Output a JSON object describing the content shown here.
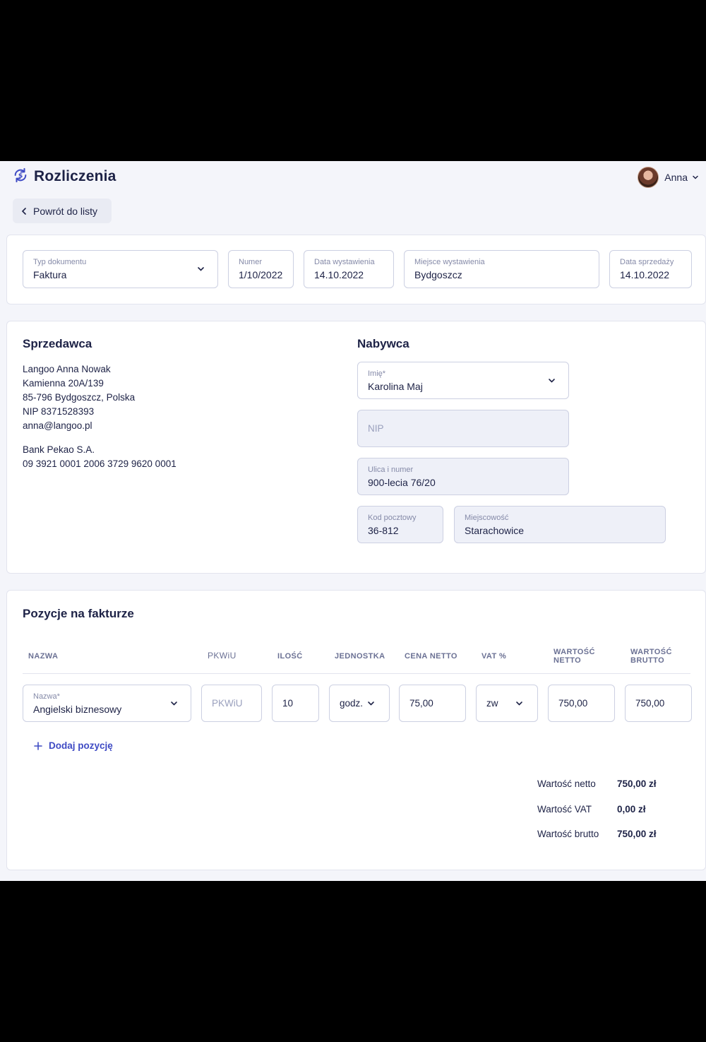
{
  "app": {
    "title": "Rozliczenia",
    "logo_icon": "refresh-coin-icon"
  },
  "user": {
    "name": "Anna"
  },
  "back": {
    "label": "Powrót do listy"
  },
  "document": {
    "type": {
      "label": "Typ dokumentu",
      "value": "Faktura"
    },
    "number": {
      "label": "Numer",
      "value": "1/10/2022"
    },
    "issue_date": {
      "label": "Data wystawienia",
      "value": "14.10.2022"
    },
    "issue_place": {
      "label": "Miejsce wystawienia",
      "value": "Bydgoszcz"
    },
    "sale_date": {
      "label": "Data sprzedaży",
      "value": "14.10.2022"
    }
  },
  "seller": {
    "title": "Sprzedawca",
    "lines": [
      "Langoo Anna Nowak",
      "Kamienna 20A/139",
      "85-796 Bydgoszcz, Polska",
      "NIP 8371528393",
      "anna@langoo.pl"
    ],
    "bank_lines": [
      "Bank Pekao S.A.",
      "09 3921 0001 2006 3729 9620 0001"
    ]
  },
  "buyer": {
    "title": "Nabywca",
    "name": {
      "label": "Imię*",
      "value": "Karolina Maj"
    },
    "nip": {
      "placeholder": "NIP"
    },
    "street": {
      "label": "Ulica i numer",
      "value": "900-lecia 76/20"
    },
    "postal": {
      "label": "Kod pocztowy",
      "value": "36-812"
    },
    "city": {
      "label": "Miejscowość",
      "value": "Starachowice"
    }
  },
  "items": {
    "title": "Pozycje na fakturze",
    "headers": {
      "name": "NAZWA",
      "pkwiu": "PKWiU",
      "qty": "ILOŚĆ",
      "unit": "JEDNOSTKA",
      "price": "CENA NETTO",
      "vat": "VAT %",
      "net": "WARTOŚĆ NETTO",
      "gross": "WARTOŚĆ BRUTTO"
    },
    "rows": [
      {
        "name_label": "Nazwa*",
        "name": "Angielski biznesowy",
        "pkwiu_placeholder": "PKWiU",
        "qty": "10",
        "unit": "godz.",
        "price": "75,00",
        "vat": "zw",
        "net": "750,00",
        "gross": "750,00"
      }
    ],
    "add_label": "Dodaj pozycję"
  },
  "summary": {
    "net_label": "Wartość netto",
    "net_value": "750,00 zł",
    "vat_label": "Wartość VAT",
    "vat_value": "0,00 zł",
    "gross_label": "Wartość brutto",
    "gross_value": "750,00 zł"
  },
  "colors": {
    "accent": "#3f4bc4",
    "text": "#1d2246",
    "border": "#ccd0e2",
    "background": "#f4f5fa"
  }
}
